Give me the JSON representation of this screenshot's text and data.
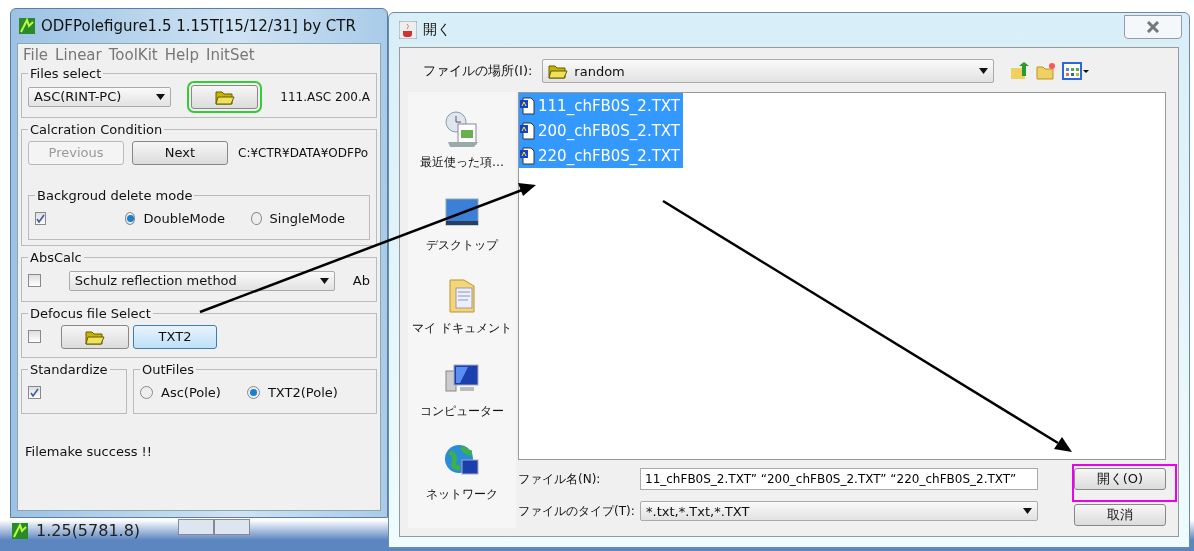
{
  "main_window": {
    "title": "ODFPolefigure1.5 1.15T[15/12/31] by CTR",
    "menu": [
      "File",
      "Linear",
      "ToolKit",
      "Help",
      "InitSet"
    ],
    "files_select": {
      "legend": "Files select",
      "format": "ASC(RINT-PC)",
      "files": "111.ASC 200.A"
    },
    "calc_condition": {
      "legend": "Calcration Condition",
      "buttons": [
        {
          "label": "Previous",
          "disabled": true
        },
        {
          "label": "Next",
          "disabled": false
        }
      ],
      "path": "C:¥CTR¥DATA¥ODFPo"
    },
    "background": {
      "legend": "Backgroud delete mode",
      "checked": true,
      "options": [
        {
          "label": "DoubleMode",
          "selected": true
        },
        {
          "label": "SingleMode",
          "selected": false
        }
      ]
    },
    "abscalc": {
      "legend": "AbsCalc",
      "checked": false,
      "method": "Schulz reflection method",
      "cut_label": "Ab"
    },
    "defocus": {
      "legend": "Defocus file Select",
      "checked": false,
      "button": "TXT2"
    },
    "standardize": {
      "legend": "Standardize",
      "checked": true
    },
    "outfiles": {
      "legend": "OutFiles",
      "options": [
        {
          "label": "Asc(Pole)",
          "selected": false
        },
        {
          "label": "TXT2(Pole)",
          "selected": true
        }
      ]
    },
    "status": "Filemake success !!"
  },
  "taskbar_item": {
    "label": "1.25(5781.8)"
  },
  "dialog": {
    "title": "開く",
    "look_in_label": "ファイルの場所(I):",
    "folder": "random",
    "places": [
      "最近使った項…",
      "デスクトップ",
      "マイ ドキュメント",
      "コンピューター",
      "ネットワーク"
    ],
    "files": [
      {
        "name": "111_chFB0S_2.TXT",
        "selected": true
      },
      {
        "name": "200_chFB0S_2.TXT",
        "selected": true
      },
      {
        "name": "220_chFB0S_2.TXT",
        "selected": true
      }
    ],
    "filename_label": "ファイル名(N):",
    "filename": "11_chFB0S_2.TXT” “200_chFB0S_2.TXT” “220_chFB0S_2.TXT”",
    "filetype_label": "ファイルのタイプ(T):",
    "filetype": "*.txt,*.Txt,*.TXT",
    "buttons": [
      "開く(O)",
      "取消"
    ]
  }
}
